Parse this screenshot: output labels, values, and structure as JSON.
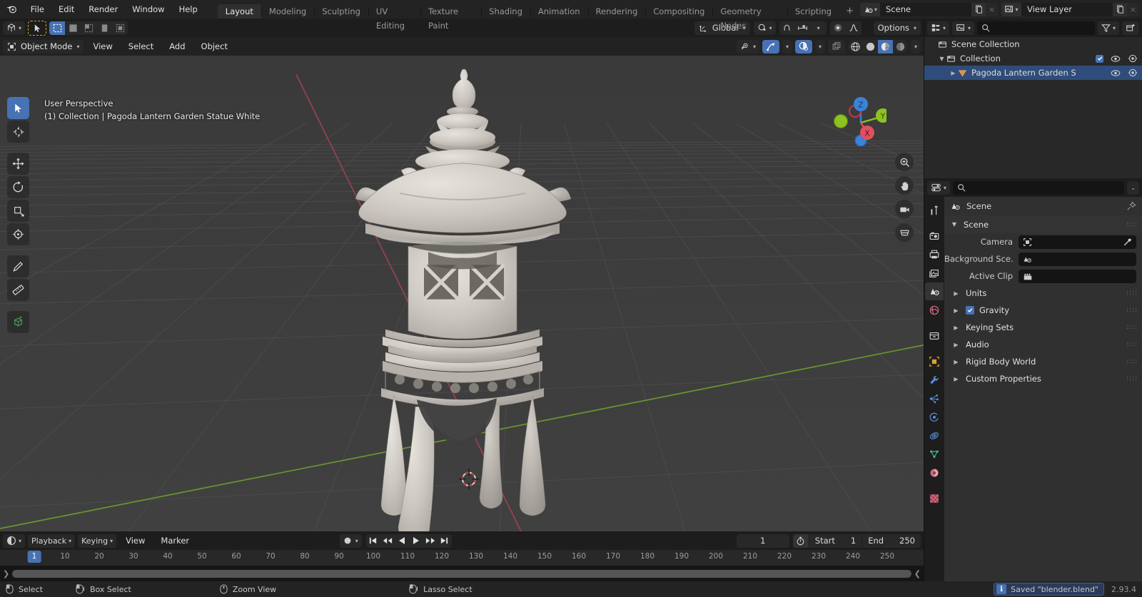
{
  "app": {
    "version": "2.93.4"
  },
  "topbar": {
    "logo_icon": "blender-logo-icon",
    "menus": [
      "File",
      "Edit",
      "Render",
      "Window",
      "Help"
    ],
    "workspaces": [
      "Layout",
      "Modeling",
      "Sculpting",
      "UV Editing",
      "Texture Paint",
      "Shading",
      "Animation",
      "Rendering",
      "Compositing",
      "Geometry Nodes",
      "Scripting"
    ],
    "active_workspace": "Layout",
    "add_workspace_label": "+",
    "scene": {
      "icon": "scene-icon",
      "name": "Scene",
      "new_label": "new-scene-icon",
      "unlink_label": "×"
    },
    "view_layer": {
      "icon": "view-layer-icon",
      "name": "View Layer",
      "new_label": "new-layer-icon",
      "unlink_label": "×"
    }
  },
  "tool_header": {
    "editor_type_icon": "editor-type-icon",
    "tool_icon": "select-box-tool-icon",
    "select_modes": [
      "set",
      "extend",
      "subtract",
      "invert",
      "intersect"
    ],
    "active_select_mode": "set",
    "transform_orientation": {
      "icon": "orientation-icon",
      "label": "Global"
    },
    "pivot_icon": "pivot-point-icon",
    "snap_magnet_icon": "snap-magnet-icon",
    "snap_to_icon": "snap-increment-icon",
    "proportional_icon": "proportional-edit-icon",
    "falloff_icon": "proportional-falloff-icon",
    "options_label": "Options"
  },
  "viewport": {
    "mode": "Object Mode",
    "menus": [
      "View",
      "Select",
      "Add",
      "Object"
    ],
    "overlay_text_line1": "User Perspective",
    "overlay_text_line2": "(1) Collection | Pagoda Lantern Garden Statue White",
    "tools": [
      {
        "name": "tweak-tool",
        "icon": "cursor-arrow-icon",
        "active": true
      },
      {
        "name": "cursor-tool",
        "icon": "3d-cursor-icon",
        "active": false
      },
      {
        "name": "move-tool",
        "icon": "move-arrows-icon",
        "active": false
      },
      {
        "name": "rotate-tool",
        "icon": "rotate-icon",
        "active": false
      },
      {
        "name": "scale-tool",
        "icon": "scale-icon",
        "active": false
      },
      {
        "name": "transform-tool",
        "icon": "transform-icon",
        "active": false
      },
      {
        "name": "annotate-tool",
        "icon": "pencil-icon",
        "active": false
      },
      {
        "name": "measure-tool",
        "icon": "ruler-icon",
        "active": false
      },
      {
        "name": "add-cube-tool",
        "icon": "add-cube-icon",
        "active": false
      }
    ],
    "gizmo_axes": [
      {
        "label": "Z",
        "color": "#3b83d8"
      },
      {
        "label": "Y",
        "color": "#8ec220"
      },
      {
        "label": "X",
        "color": "#e0505f"
      }
    ],
    "nav_buttons": [
      "zoom-icon",
      "pan-hand-icon",
      "camera-icon",
      "ortho-persp-icon"
    ],
    "shading_modes": [
      "wireframe",
      "solid",
      "material-preview",
      "rendered"
    ],
    "active_shading": "material-preview",
    "header_toggles": [
      "visibility-icon",
      "gizmo-icon",
      "overlays-icon",
      "xray-icon"
    ]
  },
  "timeline": {
    "editor_icon": "timeline-editor-icon",
    "menus": [
      "Playback",
      "Keying",
      "View",
      "Marker"
    ],
    "auto_key_icon": "record-dot-icon",
    "transport": [
      "jump-to-start",
      "jump-prev-keyframe",
      "play-reverse",
      "play",
      "jump-next-keyframe",
      "jump-to-end"
    ],
    "current_frame": "1",
    "use_preview_range_icon": "stopwatch-icon",
    "start_label": "Start",
    "start_value": "1",
    "end_label": "End",
    "end_value": "250",
    "playhead_label": "1",
    "ticks": [
      "10",
      "20",
      "30",
      "40",
      "50",
      "60",
      "70",
      "80",
      "90",
      "100",
      "110",
      "120",
      "130",
      "140",
      "150",
      "160",
      "170",
      "180",
      "190",
      "200",
      "210",
      "220",
      "230",
      "240",
      "250"
    ]
  },
  "outliner": {
    "display_mode_icon": "outliner-display-icon",
    "filter_id_icon": "filter-id-icon",
    "search_placeholder": "",
    "filter_icon": "funnel-icon",
    "new_collection_icon": "new-collection-icon",
    "rows": [
      {
        "label": "Scene Collection",
        "icon": "scene-collection-icon",
        "indent": 0,
        "expand": "",
        "selected": false,
        "checkbox": false,
        "eye": false,
        "camera": false
      },
      {
        "label": "Collection",
        "icon": "collection-icon",
        "indent": 1,
        "expand": "▼",
        "selected": false,
        "checkbox": true,
        "eye": true,
        "camera": true
      },
      {
        "label": "Pagoda Lantern Garden S",
        "icon": "mesh-object-icon",
        "indent": 2,
        "expand": "▶",
        "selected": true,
        "checkbox": false,
        "eye": true,
        "camera": true
      }
    ]
  },
  "properties": {
    "editor_icon": "properties-editor-icon",
    "search_placeholder": "",
    "options_chevron": "⌄",
    "tabs": [
      {
        "name": "tool-tab",
        "icon": "tool-screwdriver-wrench-icon",
        "active": false
      },
      {
        "name": "render-tab",
        "icon": "render-camera-back-icon",
        "active": false
      },
      {
        "name": "output-tab",
        "icon": "output-printer-icon",
        "active": false
      },
      {
        "name": "view-layer-tab",
        "icon": "view-layer-images-icon",
        "active": false
      },
      {
        "name": "scene-tab",
        "icon": "scene-cone-sphere-icon",
        "active": true
      },
      {
        "name": "world-tab",
        "icon": "world-globe-icon",
        "active": false
      },
      {
        "name": "collection-tab",
        "icon": "collection-box-icon",
        "active": false
      },
      {
        "name": "object-tab",
        "icon": "object-square-icon",
        "active": false
      },
      {
        "name": "modifier-tab",
        "icon": "wrench-icon",
        "active": false
      },
      {
        "name": "particles-tab",
        "icon": "particles-icon",
        "active": false
      },
      {
        "name": "physics-tab",
        "icon": "physics-orbit-icon",
        "active": false
      },
      {
        "name": "constraints-tab",
        "icon": "constraints-icon",
        "active": false
      },
      {
        "name": "data-tab",
        "icon": "mesh-data-triangle-icon",
        "active": false
      },
      {
        "name": "material-tab",
        "icon": "material-sphere-icon",
        "active": false
      },
      {
        "name": "texture-tab",
        "icon": "texture-checker-icon",
        "active": false
      }
    ],
    "breadcrumb": {
      "icon": "scene-cone-sphere-icon",
      "label": "Scene",
      "pin_icon": "pin-icon"
    },
    "scene_panel": {
      "title": "Scene",
      "fields": [
        {
          "label": "Camera",
          "value": "",
          "icon": "camera-data-icon",
          "has_eyedropper": true
        },
        {
          "label": "Background Sce...",
          "value": "",
          "icon": "scene-cone-sphere-icon",
          "has_eyedropper": false
        },
        {
          "label": "Active Clip",
          "value": "",
          "icon": "movie-clip-icon",
          "has_eyedropper": false
        }
      ]
    },
    "accordions": [
      {
        "label": "Units",
        "checkbox": null
      },
      {
        "label": "Gravity",
        "checkbox": true
      },
      {
        "label": "Keying Sets",
        "checkbox": null
      },
      {
        "label": "Audio",
        "checkbox": null
      },
      {
        "label": "Rigid Body World",
        "checkbox": null
      },
      {
        "label": "Custom Properties",
        "checkbox": null
      }
    ]
  },
  "status_bar": {
    "hints": [
      {
        "icon": "mouse-left-icon",
        "label": "Select"
      },
      {
        "icon": "mouse-left-drag-icon",
        "label": "Box Select"
      },
      {
        "icon": "mouse-middle-icon",
        "label": "Zoom View"
      },
      {
        "icon": "mouse-left-ctrl-icon",
        "label": "Lasso Select"
      }
    ],
    "saved_message": "Saved \"blender.blend\"",
    "version": "2.93.4"
  },
  "colors": {
    "accent_blue": "#4772b3",
    "orange": "#e09e34",
    "axis_x": "#e0505f",
    "axis_y": "#8ec220",
    "axis_z": "#3b83d8",
    "viewport_bg": "#3d3d3d",
    "panel_bg": "#303030"
  }
}
